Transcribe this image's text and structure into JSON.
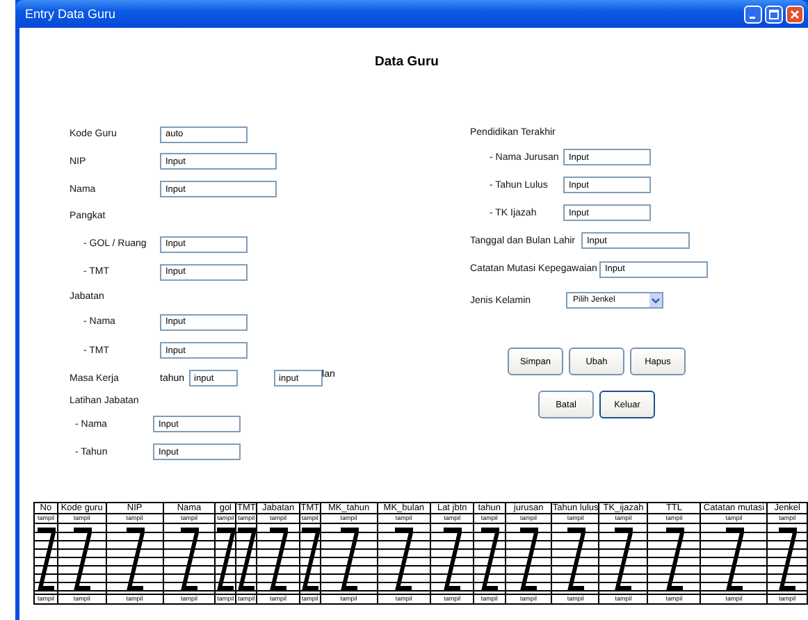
{
  "window": {
    "title": "Entry Data Guru"
  },
  "heading": "Data Guru",
  "left_form": [
    {
      "kind": "field",
      "label": "Kode Guru",
      "value": "auto"
    },
    {
      "kind": "field",
      "label": "NIP",
      "value": "Input"
    },
    {
      "kind": "field",
      "label": "Nama",
      "value": "Input"
    },
    {
      "kind": "heading",
      "label": "Pangkat"
    },
    {
      "kind": "subfield",
      "label": "- GOL / Ruang",
      "value": "Input"
    },
    {
      "kind": "subfield",
      "label": "- TMT",
      "value": "Input"
    },
    {
      "kind": "heading",
      "label": "Jabatan"
    },
    {
      "kind": "subfield",
      "label": "- Nama",
      "value": "Input"
    },
    {
      "kind": "subfield",
      "label": "- TMT",
      "value": "Input"
    },
    {
      "kind": "duration",
      "label": "Masa Kerja",
      "unit_1": "tahun",
      "value_1": "input",
      "value_2": "input",
      "unit_2": "lan"
    },
    {
      "kind": "heading",
      "label": "Latihan Jabatan"
    },
    {
      "kind": "subfield",
      "label": "- Nama",
      "value": "Input"
    },
    {
      "kind": "subfield",
      "label": "- Tahun",
      "value": "Input"
    }
  ],
  "right_form": [
    {
      "kind": "heading",
      "label": "Pendidikan Terakhir"
    },
    {
      "kind": "subfield",
      "label": "- Nama Jurusan",
      "value": "Input"
    },
    {
      "kind": "subfield",
      "label": "- Tahun Lulus",
      "value": "Input"
    },
    {
      "kind": "subfield",
      "label": "- TK Ijazah",
      "value": "Input"
    },
    {
      "kind": "field",
      "label": "Tanggal dan Bulan Lahir",
      "value": "Input"
    },
    {
      "kind": "field",
      "label": "Catatan Mutasi Kepegawaian",
      "value": "Input"
    },
    {
      "kind": "select",
      "label": "Jenis Kelamin",
      "value": "Pilih Jenkel"
    }
  ],
  "button_rows": [
    [
      {
        "label": "Simpan",
        "focused": false
      },
      {
        "label": "Ubah",
        "focused": false
      },
      {
        "label": "Hapus",
        "focused": false
      }
    ],
    [
      {
        "label": "Batal",
        "focused": false
      },
      {
        "label": "Keluar",
        "focused": true
      }
    ]
  ],
  "table": {
    "columns": [
      {
        "label": "No",
        "top": "tampil",
        "bottom": "tampil"
      },
      {
        "label": "Kode guru",
        "top": "tampil",
        "bottom": "tampil"
      },
      {
        "label": "NIP",
        "top": "tampil",
        "bottom": "tampil"
      },
      {
        "label": "Nama",
        "top": "tampil",
        "bottom": "tampil"
      },
      {
        "label": "gol",
        "top": "tampil",
        "bottom": "tampil"
      },
      {
        "label": "TMT",
        "top": "tampil",
        "bottom": "tampil"
      },
      {
        "label": "Jabatan",
        "top": "tampil",
        "bottom": "tampil"
      },
      {
        "label": "TMT",
        "top": "tampil",
        "bottom": "tampil"
      },
      {
        "label": "MK_tahun",
        "top": "tampil",
        "bottom": "tampil"
      },
      {
        "label": "MK_bulan",
        "top": "tampil",
        "bottom": "tampil"
      },
      {
        "label": "Lat jbtn",
        "top": "tampil",
        "bottom": "tampil"
      },
      {
        "label": "tahun",
        "top": "tampil",
        "bottom": "tampil"
      },
      {
        "label": "jurusan",
        "top": "tampil",
        "bottom": "tampil"
      },
      {
        "label": "Tahun lulus",
        "top": "tampil",
        "bottom": "tampil"
      },
      {
        "label": "TK_ijazah",
        "top": "tampil",
        "bottom": "tampil"
      },
      {
        "label": "TTL",
        "top": "tampil",
        "bottom": "tampil"
      },
      {
        "label": "Catatan mutasi",
        "top": "tampil",
        "bottom": "tampil"
      },
      {
        "label": "Jenkel",
        "top": "tampil",
        "bottom": "tampil"
      }
    ]
  }
}
